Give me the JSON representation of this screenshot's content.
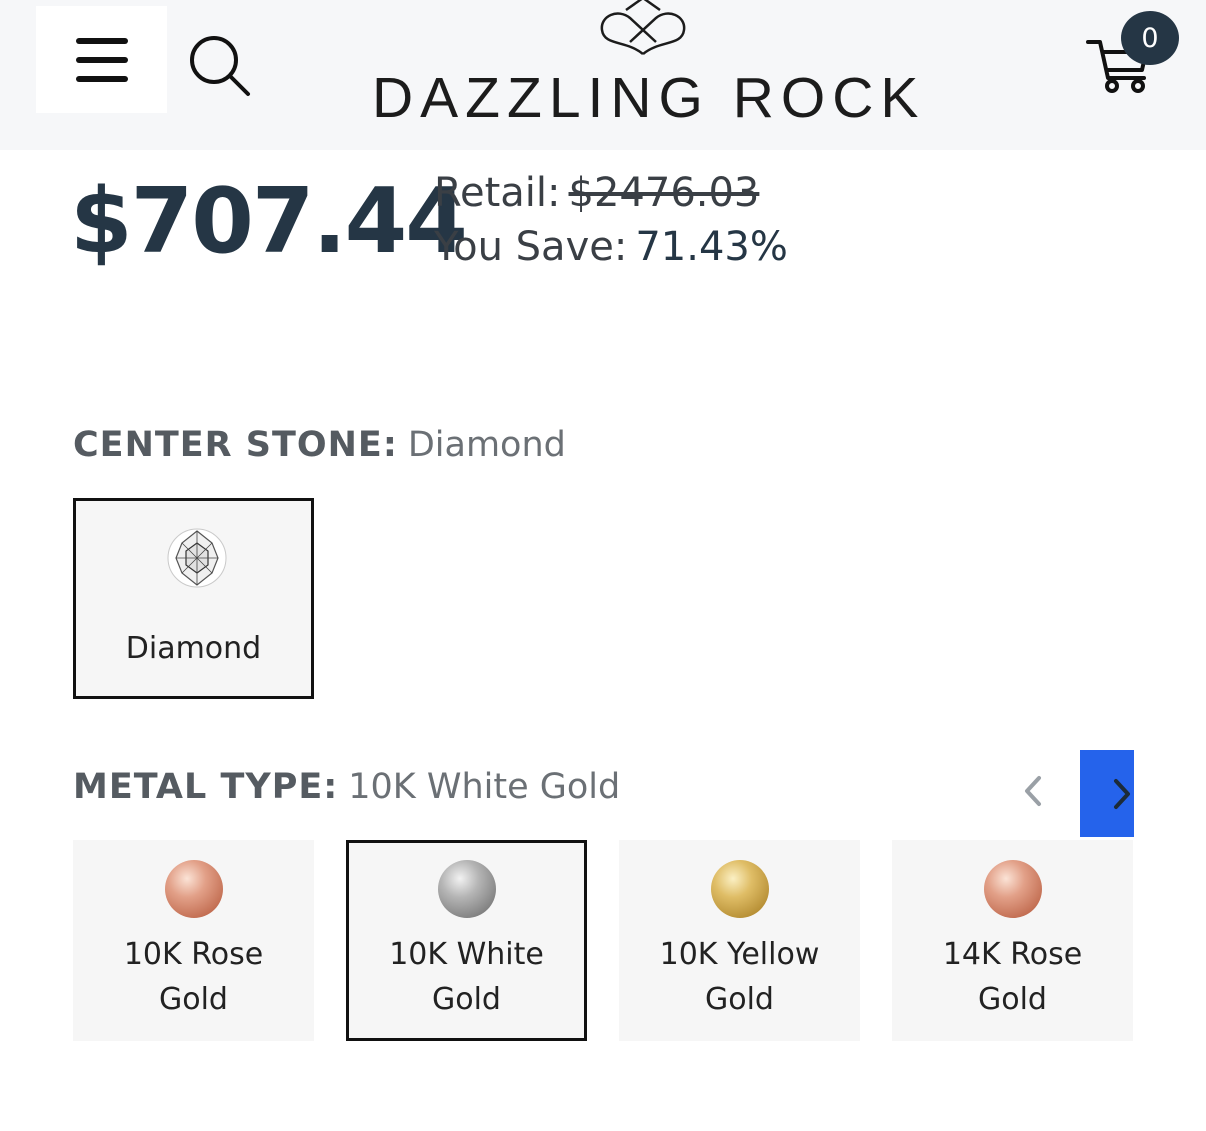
{
  "header": {
    "menu_icon": "hamburger-icon",
    "search_icon": "search-icon",
    "logo_text": "DAZZLING ROCK",
    "cart_icon": "cart-icon",
    "cart_count": "0"
  },
  "pricing": {
    "price": "$707.44",
    "retail_label": "Retail:",
    "retail_value": "$2476.03",
    "save_label": "You Save:",
    "save_value": "71.43%"
  },
  "center_stone": {
    "label": "CENTER STONE:",
    "selected": "Diamond",
    "options": [
      {
        "name": "Diamond",
        "icon": "diamond-icon",
        "selected": true
      }
    ]
  },
  "metal_type": {
    "label": "METAL TYPE:",
    "selected": "10K White Gold",
    "prev_icon": "chevron-left-icon",
    "next_icon": "chevron-right-icon",
    "options": [
      {
        "line1": "10K Rose",
        "line2": "Gold",
        "color": "#d98d72",
        "selected": false
      },
      {
        "line1": "10K White",
        "line2": "Gold",
        "color": "#a9a9a9",
        "selected": true
      },
      {
        "line1": "10K Yellow",
        "line2": "Gold",
        "color": "#d6b35a",
        "selected": false
      },
      {
        "line1": "14K Rose",
        "line2": "Gold",
        "color": "#d98d72",
        "selected": false
      }
    ]
  },
  "colors": {
    "primary": "#253645",
    "accent_blue": "#2563eb",
    "header_bg": "#f6f7f9",
    "option_bg": "#f6f6f6"
  }
}
